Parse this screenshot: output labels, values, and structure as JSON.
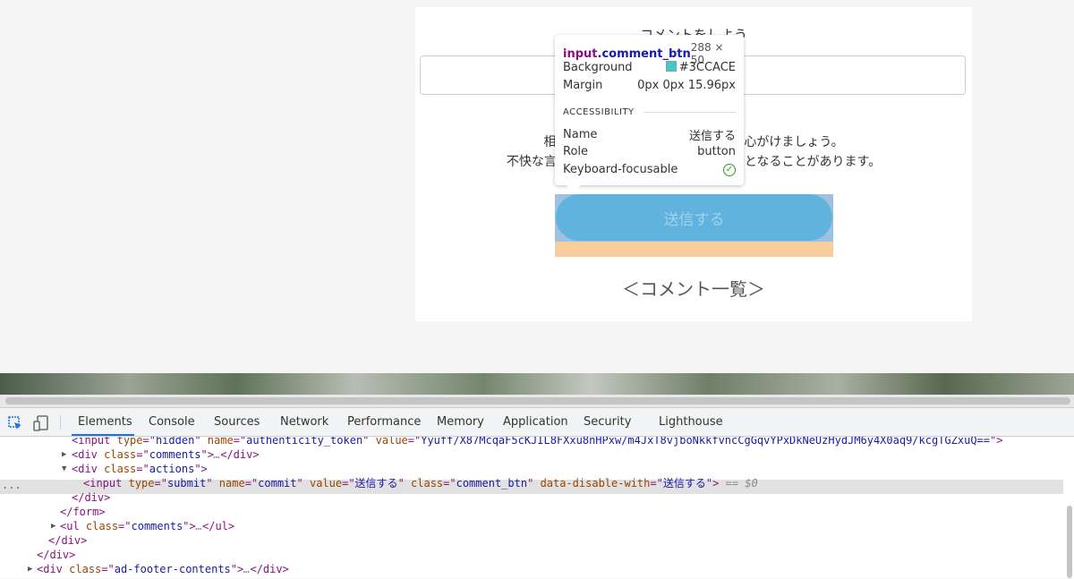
{
  "page": {
    "comment_heading": "コメントをしよう",
    "notice_line1": "相手のことを考え丁寧なコメントを心がけましょう。",
    "notice_line2": "不快な言葉遣いなどは利用制限や退会処分となることがあります。",
    "submit_button": "送信する",
    "comment_list_heading": "＜コメント一覧＞"
  },
  "tooltip": {
    "tag": "input",
    "class": ".comment_btn",
    "size": "288 × 50",
    "background_label": "Background",
    "background_value": "#3CCACE",
    "margin_label": "Margin",
    "margin_value": "0px 0px 15.96px",
    "accessibility_heading": "ACCESSIBILITY",
    "name_label": "Name",
    "name_value": "送信する",
    "role_label": "Role",
    "role_value": "button",
    "focus_label": "Keyboard-focusable"
  },
  "devtools": {
    "tabs": [
      "Elements",
      "Console",
      "Sources",
      "Network",
      "Performance",
      "Memory",
      "Application",
      "Security",
      "Lighthouse"
    ],
    "active_tab": "Elements",
    "dom": {
      "line0": {
        "tag": "input",
        "a1": "type",
        "v1": "hidden",
        "a2": "name",
        "v2": "authenticity_token",
        "a3": "value",
        "v3": "Yyuff/X87McqaF5cKJIL8FXxu8nHPxw/m4JxT8vjboNkkfvncCgGqvYPxDkNeUzHydJM6y4X0aq9/kcgTGZxuQ=="
      },
      "line1": {
        "tag": "div",
        "a1": "class",
        "v1": "comments",
        "collapsed": "…",
        "close": "div"
      },
      "line2": {
        "tag": "div",
        "a1": "class",
        "v1": "actions"
      },
      "line3": {
        "tag": "input",
        "a1": "type",
        "v1": "submit",
        "a2": "name",
        "v2": "commit",
        "a3": "value",
        "v3": "送信する",
        "a4": "class",
        "v4": "comment_btn",
        "a5": "data-disable-with",
        "v5": "送信する",
        "suffix": "== $0"
      },
      "line4": "</div>",
      "line5": "</form>",
      "line6": {
        "tag": "ul",
        "a1": "class",
        "v1": "comments",
        "collapsed": "…",
        "close": "ul"
      },
      "line7": "</div>",
      "line8": "</div>",
      "line9": {
        "tag": "div",
        "a1": "class",
        "v1": "ad-footer-contents",
        "collapsed": "…",
        "close": "div"
      },
      "ellipsis": "..."
    }
  },
  "colors": {
    "button_bg": "#5fb3dc",
    "swatch": "#3ccace",
    "margin_overlay": "#f8cd9b",
    "content_overlay": "#9fc1e1"
  }
}
